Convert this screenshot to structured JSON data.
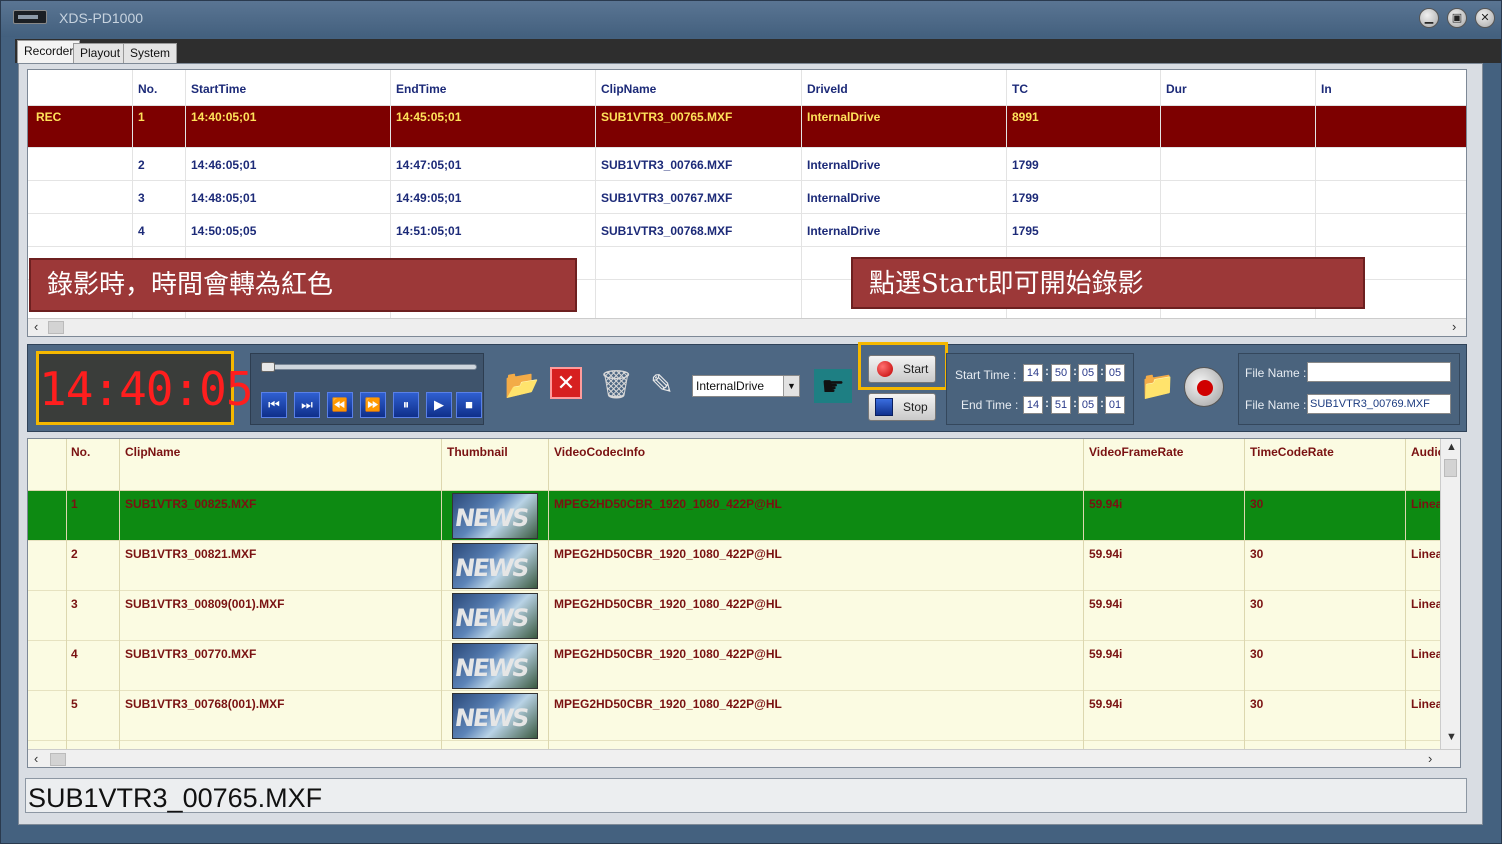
{
  "window": {
    "title": "XDS-PD1000",
    "minimize": "▁",
    "maximize": "▣",
    "close": "✕"
  },
  "tabs": [
    "Recorder",
    "Playout",
    "System"
  ],
  "schedule": {
    "headers": [
      "No.",
      "StartTime",
      "EndTime",
      "ClipName",
      "DriveId",
      "TC",
      "Dur",
      "In"
    ],
    "rows": [
      {
        "status": "REC",
        "no": "1",
        "start": "14:40:05;01",
        "end": "14:45:05;01",
        "clip": "SUB1VTR3_00765.MXF",
        "drive": "InternalDrive",
        "tc": "8991"
      },
      {
        "status": "",
        "no": "2",
        "start": "14:46:05;01",
        "end": "14:47:05;01",
        "clip": "SUB1VTR3_00766.MXF",
        "drive": "InternalDrive",
        "tc": "1799"
      },
      {
        "status": "",
        "no": "3",
        "start": "14:48:05;01",
        "end": "14:49:05;01",
        "clip": "SUB1VTR3_00767.MXF",
        "drive": "InternalDrive",
        "tc": "1799"
      },
      {
        "status": "",
        "no": "4",
        "start": "14:50:05;05",
        "end": "14:51:05;01",
        "clip": "SUB1VTR3_00768.MXF",
        "drive": "InternalDrive",
        "tc": "1795"
      }
    ]
  },
  "callouts": {
    "left": "錄影時，時間會轉為紅色",
    "right": "點選Start即可開始錄影"
  },
  "clock": "14:40:05",
  "drive_select": "InternalDrive",
  "buttons": {
    "start": "Start",
    "stop": "Stop"
  },
  "times": {
    "start_label": "Start Time :",
    "end_label": "End Time :",
    "start": [
      "14",
      "50",
      "05",
      "05"
    ],
    "end": [
      "14",
      "51",
      "05",
      "01"
    ]
  },
  "file": {
    "label1": "File Name :",
    "label2": "File Name :",
    "value1": "",
    "value2": "SUB1VTR3_00769.MXF"
  },
  "clips": {
    "headers": [
      "No.",
      "ClipName",
      "Thumbnail",
      "VideoCodecInfo",
      "VideoFrameRate",
      "TimeCodeRate",
      "Audio"
    ],
    "rows": [
      {
        "no": "1",
        "clip": "SUB1VTR3_00825.MXF",
        "codec": "MPEG2HD50CBR_1920_1080_422P@HL",
        "fps": "59.94i",
        "tcr": "30",
        "audio": "Linea"
      },
      {
        "no": "2",
        "clip": "SUB1VTR3_00821.MXF",
        "codec": "MPEG2HD50CBR_1920_1080_422P@HL",
        "fps": "59.94i",
        "tcr": "30",
        "audio": "Linea"
      },
      {
        "no": "3",
        "clip": "SUB1VTR3_00809(001).MXF",
        "codec": "MPEG2HD50CBR_1920_1080_422P@HL",
        "fps": "59.94i",
        "tcr": "30",
        "audio": "Linea"
      },
      {
        "no": "4",
        "clip": "SUB1VTR3_00770.MXF",
        "codec": "MPEG2HD50CBR_1920_1080_422P@HL",
        "fps": "59.94i",
        "tcr": "30",
        "audio": "Linea"
      },
      {
        "no": "5",
        "clip": "SUB1VTR3_00768(001).MXF",
        "codec": "MPEG2HD50CBR_1920_1080_422P@HL",
        "fps": "59.94i",
        "tcr": "30",
        "audio": "Linea"
      }
    ],
    "thumb_text": "NEWS"
  },
  "status": "SUB1VTR3_00765.MXF",
  "colors": {
    "rec_row": "#7d0000",
    "rec_text": "#ffe25a",
    "selected_clip": "#0d8a12",
    "clock": "#ff1e1e",
    "highlight": "#f5b800"
  }
}
